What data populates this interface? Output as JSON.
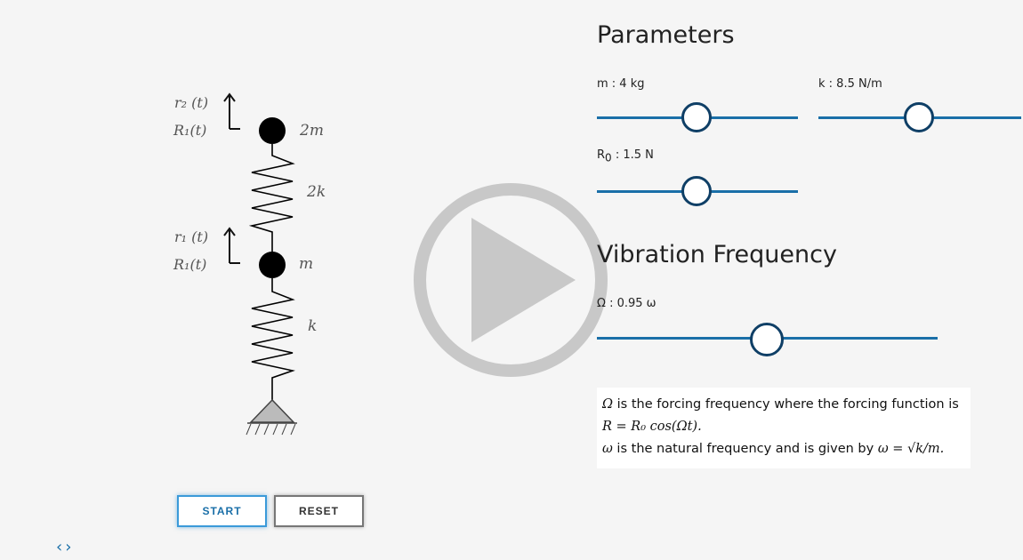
{
  "diagram": {
    "r2": "r₂ (t)",
    "R1_top": "R₁(t)",
    "r1": "r₁ (t)",
    "R1_bottom": "R₁(t)",
    "mass_top": "2m",
    "spring_top": "2k",
    "mass_bottom": "m",
    "spring_bottom": "k"
  },
  "parameters": {
    "heading": "Parameters",
    "m_label": "m : 4 kg",
    "k_label": "k : 8.5 N/m",
    "R0_label_main": "R",
    "R0_label_sub": "0",
    "R0_label_rest": ": 1.5 N",
    "m_value": 0.5,
    "k_value": 0.5,
    "R0_value": 0.5
  },
  "vibration": {
    "heading": "Vibration Frequency",
    "omega_label": "Ω : 0.95 ω",
    "omega_value": 0.5
  },
  "info": {
    "line1_sym": "Ω",
    "line1_text": " is the forcing frequency where the forcing function is",
    "line2": "R = R₀ cos(Ωt).",
    "line3_sym": "ω",
    "line3_text": " is the natural frequency and is given by ",
    "line3_formula": "ω = √k/m."
  },
  "buttons": {
    "start": "START",
    "reset": "RESET"
  },
  "nav": {
    "prev": "‹",
    "next": "›"
  },
  "colors": {
    "accent": "#1a6fa8",
    "knob_border": "#0f3f66"
  }
}
